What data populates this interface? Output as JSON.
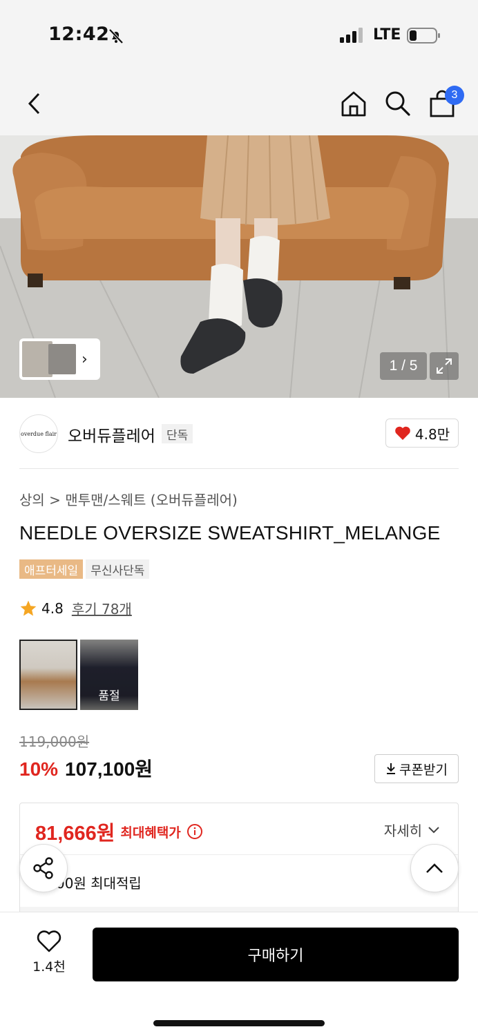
{
  "status_bar": {
    "time": "12:42",
    "network": "LTE"
  },
  "header": {
    "cart_count": "3"
  },
  "gallery": {
    "pager": "1 / 5"
  },
  "brand": {
    "logo_text": "overdue flair",
    "name": "오버듀플레어",
    "tag": "단독",
    "likes": "4.8만"
  },
  "product": {
    "category": "상의",
    "breadcrumb": "맨투맨/스웨트 (오버듀플레어)",
    "title": "NEEDLE OVERSIZE SWEATSHIRT_MELANGE",
    "tags": [
      "애프터세일",
      "무신사단독"
    ],
    "rating": "4.8",
    "reviews": "후기 78개",
    "option_sold_label": "품절"
  },
  "pricing": {
    "original": "119,000원",
    "discount": "10%",
    "sale": "107,100원",
    "coupon_label": "쿠폰받기",
    "best_price": "81,666원",
    "best_price_label": "최대혜택가",
    "detail_label": "자세히",
    "points": "00원 최대적립"
  },
  "bottom": {
    "wish_count": "1.4천",
    "buy_label": "구매하기"
  },
  "colors": {
    "accent_red": "#e0261f",
    "tag_orange": "#e9b985",
    "badge_blue": "#2f6bf3"
  }
}
